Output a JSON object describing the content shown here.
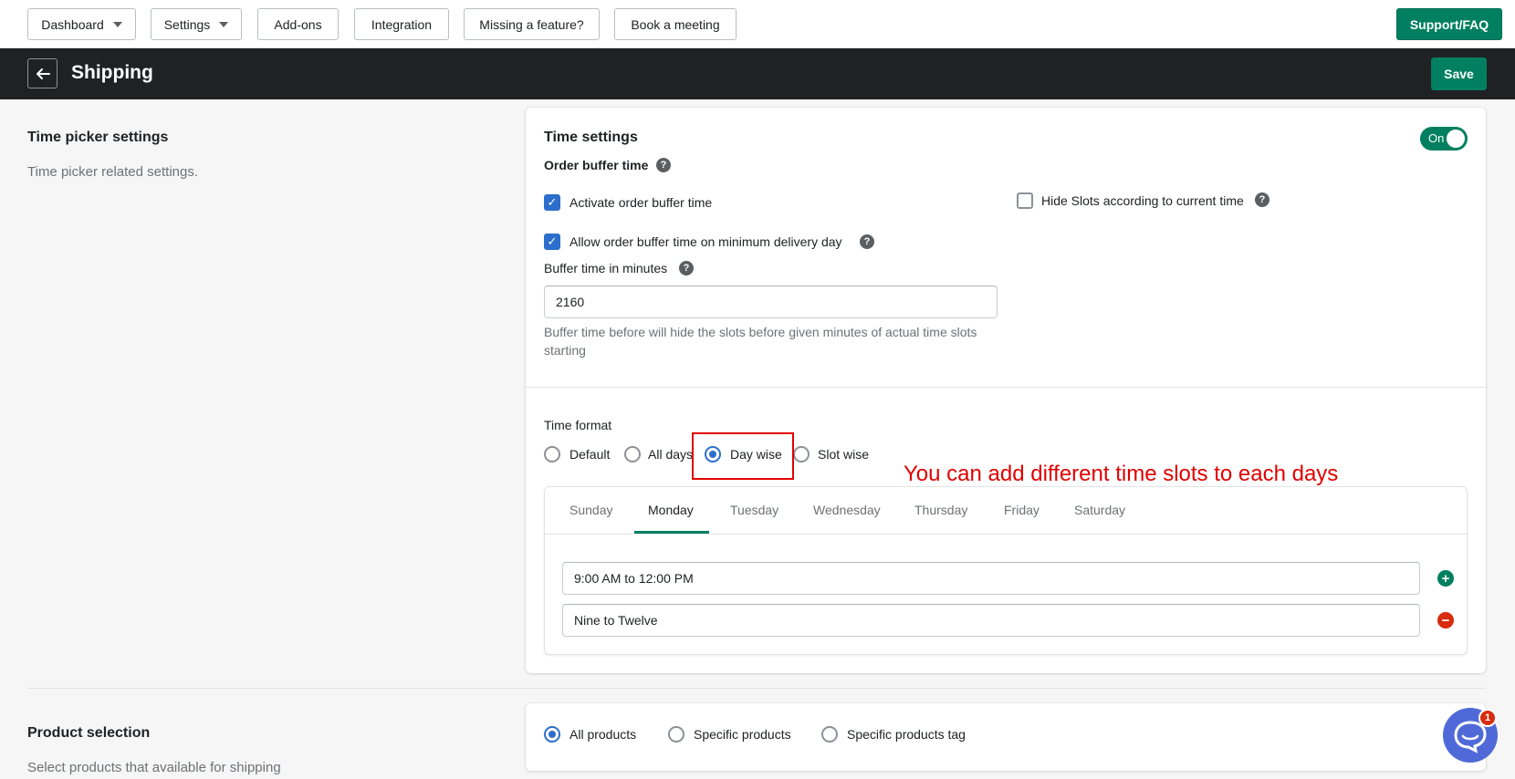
{
  "topnav": {
    "items": [
      {
        "label": "Dashboard",
        "dropdown": true
      },
      {
        "label": "Settings",
        "dropdown": true
      },
      {
        "label": "Add-ons",
        "dropdown": false
      },
      {
        "label": "Integration",
        "dropdown": false
      },
      {
        "label": "Missing a feature?",
        "dropdown": false
      },
      {
        "label": "Book a meeting",
        "dropdown": false
      }
    ],
    "support_label": "Support/FAQ"
  },
  "header": {
    "title": "Shipping",
    "save_label": "Save",
    "back_icon": "arrow-left-icon"
  },
  "time_picker_section": {
    "title": "Time picker settings",
    "description": "Time picker related settings."
  },
  "time_settings": {
    "title": "Time settings",
    "toggle_label": "On",
    "toggle_on": true,
    "order_buffer_label": "Order buffer time",
    "activate_buffer_label": "Activate order buffer time",
    "activate_buffer_checked": true,
    "allow_buffer_label": "Allow order buffer time on minimum delivery day",
    "allow_buffer_checked": true,
    "hide_slots_label": "Hide Slots according to current time",
    "hide_slots_checked": false,
    "buffer_minutes_label": "Buffer time in minutes",
    "buffer_minutes_value": "2160",
    "buffer_help_line1": "Buffer time before will hide the slots before given minutes of actual time slots",
    "buffer_help_line2": "starting",
    "help_glyph": "?"
  },
  "time_format": {
    "label": "Time format",
    "options": [
      "Default",
      "All days",
      "Day wise",
      "Slot wise"
    ],
    "selected": "Day wise"
  },
  "annotation": "You can add different time slots to each days",
  "day_tabs": {
    "tabs": [
      "Sunday",
      "Monday",
      "Tuesday",
      "Wednesday",
      "Thursday",
      "Friday",
      "Saturday"
    ],
    "active": "Monday"
  },
  "slot": {
    "time_value": "9:00 AM to 12:00 PM",
    "label_value": "Nine to Twelve",
    "add_icon": "plus-circle-icon",
    "remove_icon": "minus-circle-icon"
  },
  "product_section": {
    "title": "Product selection",
    "description": "Select products that available for shipping",
    "options": [
      "All products",
      "Specific products",
      "Specific products tag"
    ],
    "selected": "All products"
  },
  "chat": {
    "badge_count": "1",
    "icon": "chat-bubble-icon"
  },
  "colors": {
    "primary": "#008060",
    "header_bg": "#202123",
    "accent_blue": "#2c6ecb",
    "annotation_red": "#e00000"
  }
}
